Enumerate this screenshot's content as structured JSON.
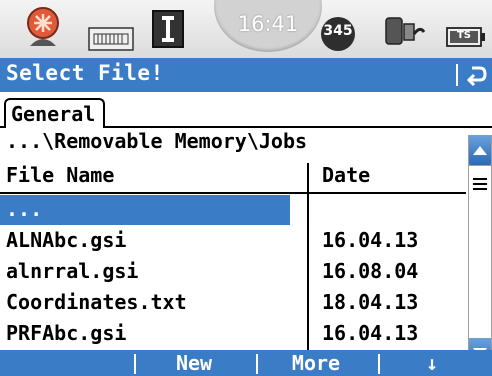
{
  "status_bar": {
    "time": "16:41",
    "badge_number": "345",
    "battery_label": "TS",
    "icons": [
      "satellite-icon",
      "memory-card-icon",
      "instrument-icon",
      "bluetooth-device-icon",
      "battery-icon"
    ]
  },
  "title_bar": {
    "title": "Select File!",
    "back_icon": "back-arrow-icon"
  },
  "tabs": [
    {
      "label": "General",
      "active": true
    }
  ],
  "path": "...\\Removable Memory\\Jobs",
  "table": {
    "columns": [
      "File Name",
      "Date"
    ],
    "rows": [
      {
        "name": "...",
        "date": "",
        "selected": true
      },
      {
        "name": "ALNAbc.gsi",
        "date": "16.04.13",
        "selected": false
      },
      {
        "name": "alnrral.gsi",
        "date": "16.08.04",
        "selected": false
      },
      {
        "name": "Coordinates.txt",
        "date": "18.04.13",
        "selected": false
      },
      {
        "name": "PRFAbc.gsi",
        "date": "16.04.13",
        "selected": false
      }
    ]
  },
  "softkeys": [
    "",
    "New",
    "More",
    "↓"
  ],
  "colors": {
    "accent": "#3a7cc6",
    "selection": "#3a7cc6",
    "text": "#000000"
  }
}
